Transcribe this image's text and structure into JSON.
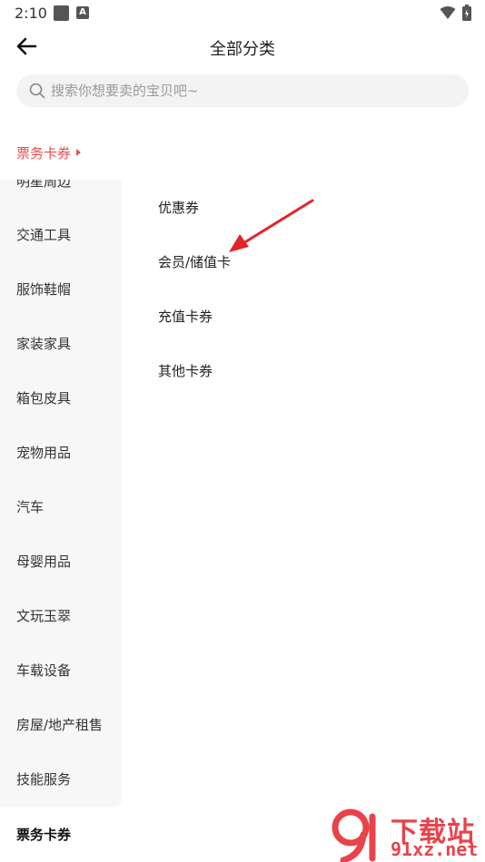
{
  "status_bar": {
    "time": "2:10",
    "indicator_letter": "A"
  },
  "header": {
    "title": "全部分类"
  },
  "search": {
    "placeholder": "搜索你想要卖的宝贝吧~"
  },
  "current_category": {
    "label": "票务卡券"
  },
  "sidebar": {
    "items": [
      {
        "label": "明星周边"
      },
      {
        "label": "交通工具"
      },
      {
        "label": "服饰鞋帽"
      },
      {
        "label": "家装家具"
      },
      {
        "label": "箱包皮具"
      },
      {
        "label": "宠物用品"
      },
      {
        "label": "汽车"
      },
      {
        "label": "母婴用品"
      },
      {
        "label": "文玩玉翠"
      },
      {
        "label": "车载设备"
      },
      {
        "label": "房屋/地产租售"
      },
      {
        "label": "技能服务"
      }
    ],
    "active_item": {
      "label": "票务卡券"
    }
  },
  "subcategories": [
    {
      "label": "优惠券"
    },
    {
      "label": "会员/储值卡"
    },
    {
      "label": "充值卡券"
    },
    {
      "label": "其他卡券"
    }
  ],
  "watermark": {
    "text_cn": "下载站",
    "text_url": "91xz.net"
  },
  "colors": {
    "accent": "#e8504a",
    "sidebar_bg": "#f7f7f7",
    "search_bg": "#f3f3f3"
  }
}
